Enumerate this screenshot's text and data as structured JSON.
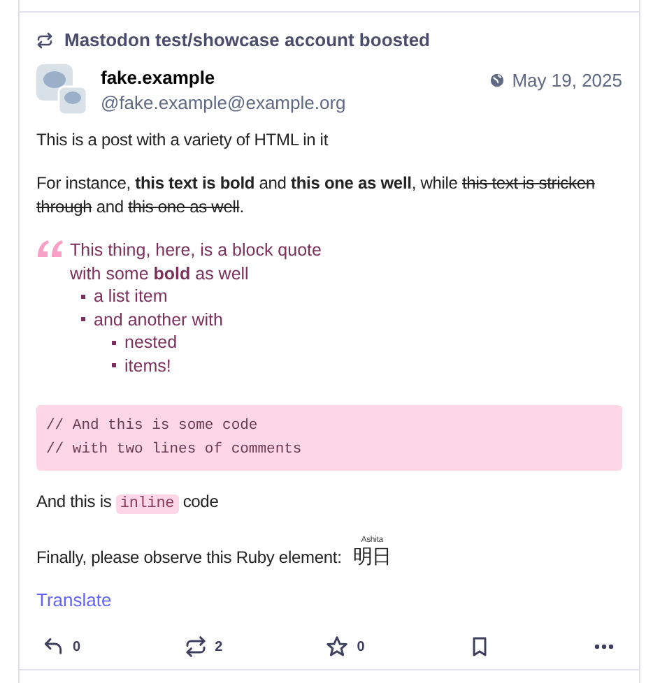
{
  "boost": {
    "text": "Mastodon test/showcase account boosted"
  },
  "author": {
    "name": "fake.example",
    "handle": "@fake.example@example.org"
  },
  "date": "May 19, 2025",
  "intro": "This is a post with a variety of HTML in it",
  "paragraph": [
    {
      "kind": "plain",
      "text": "For instance, "
    },
    {
      "kind": "bold",
      "text": "this text is bold"
    },
    {
      "kind": "plain",
      "text": " and "
    },
    {
      "kind": "bold",
      "text": "this one as well"
    },
    {
      "kind": "plain",
      "text": ", while "
    },
    {
      "kind": "strike",
      "text": "this text is stricken through"
    },
    {
      "kind": "plain",
      "text": " and "
    },
    {
      "kind": "strike",
      "text": "this one as well"
    },
    {
      "kind": "plain",
      "text": "."
    }
  ],
  "quote": {
    "lines": [
      "This thing, here, is a block quote",
      "with some **bold** as well"
    ],
    "list": [
      {
        "text": "a list item"
      },
      {
        "text": "and another with",
        "children": [
          {
            "text": "nested"
          },
          {
            "text": "items!"
          }
        ]
      }
    ]
  },
  "code_block": [
    "// And this is some code",
    "// with two lines of comments"
  ],
  "inline_code": {
    "before": "And this is",
    "code": "inline",
    "after": "code"
  },
  "ruby": {
    "text": "Finally, please observe this Ruby element:",
    "base": "明日",
    "annotation": "Ashita"
  },
  "translate": "Translate",
  "actions": [
    {
      "kind": "reply",
      "count": "0"
    },
    {
      "kind": "boost",
      "count": "2"
    },
    {
      "kind": "favourite",
      "count": "0"
    },
    {
      "kind": "bookmark"
    },
    {
      "kind": "more"
    }
  ]
}
